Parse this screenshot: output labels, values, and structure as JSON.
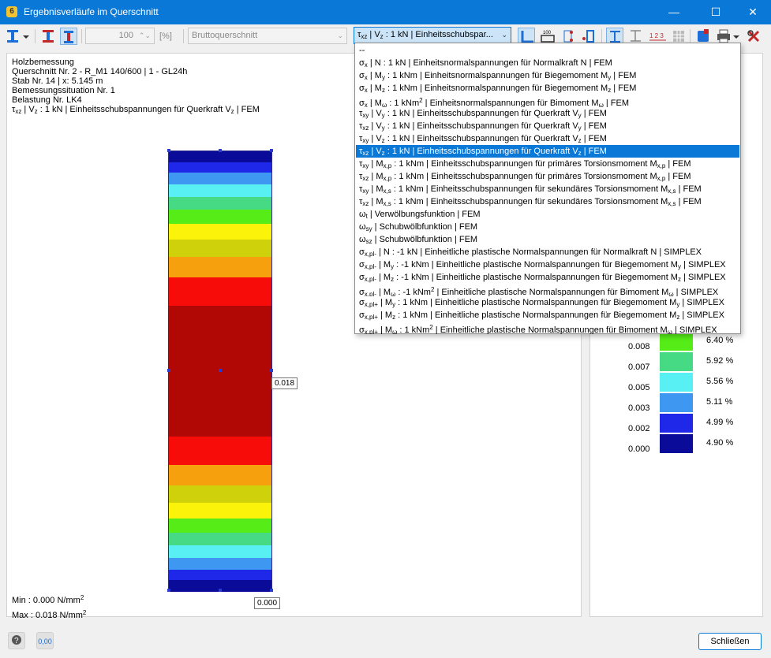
{
  "window": {
    "title": "Ergebnisverläufe im Querschnitt",
    "minimize": "—",
    "maximize": "☐",
    "close": "✕"
  },
  "toolbar": {
    "zoom_value": "100",
    "zoom_unit": "[%]",
    "section_combo": "Bruttoquerschnitt",
    "result_combo_html": "τ<sub>xz</sub> | V<sub>z</sub> : 1 kN | Einheitsschubspar..."
  },
  "info": {
    "line1": "Holzbemessung",
    "line2": "Querschnitt Nr. 2 - R_M1 140/600 | 1 - GL24h",
    "line3": "Stab Nr. 14 | x: 5.145 m",
    "line4": "Bemessungssituation Nr. 1",
    "line5": "Belastung Nr. LK4",
    "line6_html": "τ<sub>xz</sub> | V<sub>z</sub> : 1 kN | Einheitsschubspannungen für Querkraft V<sub>z</sub> | FEM"
  },
  "minmax": {
    "min_html": "Min : 0.000 N/mm<sup>2</sup>",
    "max_html": "Max : 0.018 N/mm<sup>2</sup>"
  },
  "labels": {
    "mid_value": "0.018",
    "bottom_value": "0.000"
  },
  "bands": [
    {
      "h": 14,
      "color": "#0b0b9a"
    },
    {
      "h": 13,
      "color": "#1f27e8"
    },
    {
      "h": 15,
      "color": "#3e98f1"
    },
    {
      "h": 16,
      "color": "#58f0f3"
    },
    {
      "h": 16,
      "color": "#47da85"
    },
    {
      "h": 18,
      "color": "#56ec18"
    },
    {
      "h": 20,
      "color": "#fbf30a"
    },
    {
      "h": 22,
      "color": "#cfd20b"
    },
    {
      "h": 26,
      "color": "#f7a00d"
    },
    {
      "h": 36,
      "color": "#f70c0a"
    },
    {
      "h": 166,
      "color": "#b20805"
    },
    {
      "h": 36,
      "color": "#f70c0a"
    },
    {
      "h": 26,
      "color": "#f7a00d"
    },
    {
      "h": 22,
      "color": "#cfd20b"
    },
    {
      "h": 20,
      "color": "#fbf30a"
    },
    {
      "h": 18,
      "color": "#56ec18"
    },
    {
      "h": 16,
      "color": "#47da85"
    },
    {
      "h": 16,
      "color": "#58f0f3"
    },
    {
      "h": 15,
      "color": "#3e98f1"
    },
    {
      "h": 13,
      "color": "#1f27e8"
    },
    {
      "h": 15,
      "color": "#0b0b9a"
    }
  ],
  "legend": {
    "rows": [
      {
        "color": "#56ec18",
        "pct": "6.40 %"
      },
      {
        "color": "#47da85",
        "pct": "5.92 %"
      },
      {
        "color": "#58f0f3",
        "pct": "5.56 %"
      },
      {
        "color": "#3e98f1",
        "pct": "5.11 %"
      },
      {
        "color": "#1f27e8",
        "pct": "4.99 %"
      },
      {
        "color": "#0b0b9a",
        "pct": "4.90 %"
      }
    ],
    "values": [
      "0.008",
      "0.007",
      "0.005",
      "0.003",
      "0.002",
      "0.000"
    ]
  },
  "dropdown": {
    "selected_index": 8,
    "items_html": [
      "--",
      "σ<sub>x</sub> | N : 1 kN | Einheitsnormalspannungen für Normalkraft N | FEM",
      "σ<sub>x</sub> | M<sub>y</sub> : 1 kNm | Einheitsnormalspannungen für Biegemoment M<sub>y</sub> | FEM",
      "σ<sub>x</sub> | M<sub>z</sub> : 1 kNm | Einheitsnormalspannungen für Biegemoment M<sub>z</sub> | FEM",
      "σ<sub>x</sub> | M<sub>ω</sub> : 1 kNm<sup>2</sup> | Einheitsnormalspannungen für Bimoment M<sub>ω</sub> | FEM",
      "τ<sub>xy</sub> | V<sub>y</sub> : 1 kN | Einheitsschubspannungen für Querkraft V<sub>y</sub> | FEM",
      "τ<sub>xz</sub> | V<sub>y</sub> : 1 kN | Einheitsschubspannungen für Querkraft V<sub>y</sub> | FEM",
      "τ<sub>xy</sub> | V<sub>z</sub> : 1 kN | Einheitsschubspannungen für Querkraft V<sub>z</sub> | FEM",
      "τ<sub>xz</sub> | V<sub>z</sub> : 1 kN | Einheitsschubspannungen für Querkraft V<sub>z</sub> | FEM",
      "τ<sub>xy</sub> | M<sub>x,p</sub> : 1 kNm | Einheitsschubspannungen für primäres Torsionsmoment M<sub>x,p</sub> | FEM",
      "τ<sub>xz</sub> | M<sub>x,p</sub> : 1 kNm | Einheitsschubspannungen für primäres Torsionsmoment M<sub>x,p</sub> | FEM",
      "τ<sub>xy</sub> | M<sub>x,s</sub> : 1 kNm | Einheitsschubspannungen für sekundäres Torsionsmoment M<sub>x,s</sub> | FEM",
      "τ<sub>xz</sub> | M<sub>x,s</sub> : 1 kNm | Einheitsschubspannungen für sekundäres Torsionsmoment M<sub>x,s</sub> | FEM",
      "ω<sub>t</sub> | Verwölbungsfunktion | FEM",
      "ω<sub>sy</sub> | Schubwölbfunktion | FEM",
      "ω<sub>sz</sub> | Schubwölbfunktion | FEM",
      "σ<sub>x,pl-</sub> | N : -1 kN | Einheitliche plastische Normalspannungen für Normalkraft N | SIMPLEX",
      "σ<sub>x,pl-</sub> | M<sub>y</sub> : -1 kNm | Einheitliche plastische Normalspannungen für Biegemoment M<sub>y</sub> | SIMPLEX",
      "σ<sub>x,pl-</sub> | M<sub>z</sub> : -1 kNm | Einheitliche plastische Normalspannungen für Biegemoment M<sub>z</sub> | SIMPLEX",
      "σ<sub>x,pl-</sub> | M<sub>ω</sub> : -1 kNm<sup>2</sup> | Einheitliche plastische Normalspannungen für Bimoment M<sub>ω</sub> | SIMPLEX",
      "σ<sub>x,pl+</sub> | M<sub>y</sub> : 1 kNm | Einheitliche plastische Normalspannungen für Biegemoment M<sub>y</sub> | SIMPLEX",
      "σ<sub>x,pl+</sub> | M<sub>z</sub> : 1 kNm | Einheitliche plastische Normalspannungen für Biegemoment M<sub>z</sub> | SIMPLEX",
      "σ<sub>x,pl+</sub> | M<sub>ω</sub> : 1 kNm<sup>2</sup> | Einheitliche plastische Normalspannungen für Bimoment M<sub>ω</sub> | SIMPLEX"
    ]
  },
  "footer": {
    "close_label": "Schließen",
    "decimals_icon_text": "0,00"
  }
}
